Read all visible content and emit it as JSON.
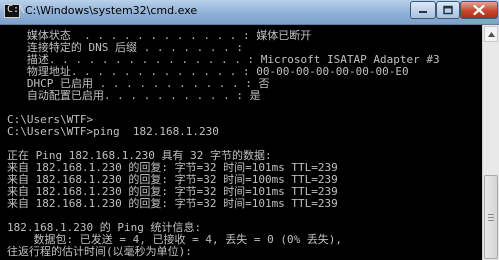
{
  "window": {
    "title": "C:\\Windows\\system32\\cmd.exe",
    "icon_glyph": "C:\\"
  },
  "console": {
    "lines": [
      "   媒体状态  . . . . . . . . . . . . : 媒体已断开",
      "   连接特定的 DNS 后缀 . . . . . . . :",
      "   描述. . . . . . . . . . . . . . . : Microsoft ISATAP Adapter #3",
      "   物理地址. . . . . . . . . . . . . : 00-00-00-00-00-00-00-E0",
      "   DHCP 已启用 . . . . . . . . . . . : 否",
      "   自动配置已启用. . . . . . . . . . : 是",
      "",
      "C:\\Users\\WTF>",
      "C:\\Users\\WTF>ping  182.168.1.230",
      "",
      "正在 Ping 182.168.1.230 具有 32 字节的数据:",
      "来自 182.168.1.230 的回复: 字节=32 时间=101ms TTL=239",
      "来自 182.168.1.230 的回复: 字节=32 时间=100ms TTL=239",
      "来自 182.168.1.230 的回复: 字节=32 时间=101ms TTL=239",
      "来自 182.168.1.230 的回复: 字节=32 时间=101ms TTL=239",
      "",
      "182.168.1.230 的 Ping 统计信息:",
      "    数据包: 已发送 = 4, 已接收 = 4, 丢失 = 0 (0% 丢失),",
      "往返行程的估计时间(以毫秒为单位):"
    ]
  },
  "colors": {
    "console_bg": "#000000",
    "console_text": "#c0c0c0",
    "close_button": "#c8462f",
    "titlebar": "#9cbbe0"
  },
  "icons": [
    "cmd-app-icon",
    "minimize-icon",
    "maximize-icon",
    "close-icon",
    "scroll-up-arrow-icon"
  ]
}
